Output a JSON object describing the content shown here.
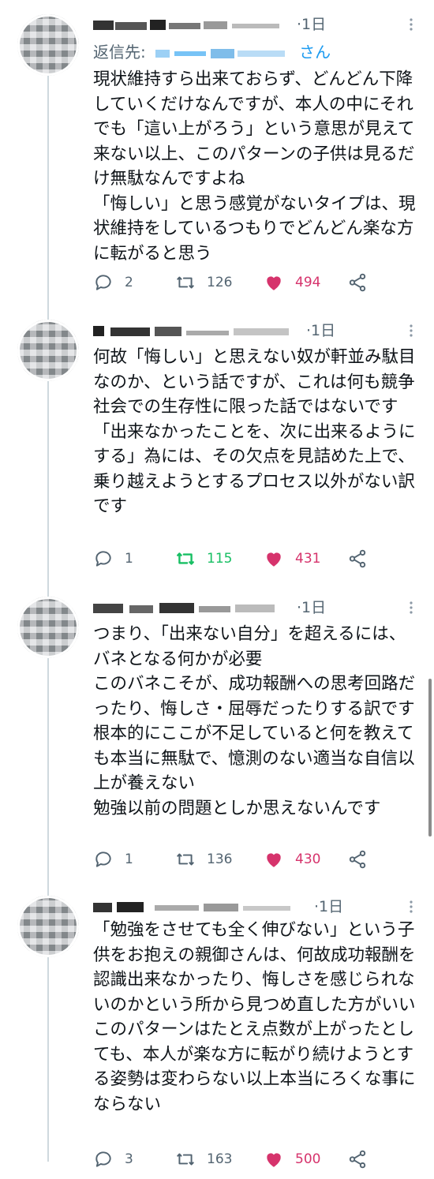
{
  "replying_label": "返信先:",
  "replying_suffix": "さん",
  "tweets": [
    {
      "time": "1日",
      "text": "現状維持すら出来ておらず、どんどん下降していくだけなんですが、本人の中にそれでも「這い上がろう」という意思が見えて来ない以上、このパターンの子供は見るだけ無駄なんですよね\n「悔しい」と思う感覚がないタイプは、現状維持をしているつもりでどんどん楽な方に転がると思う",
      "replies": "2",
      "retweets": "126",
      "likes": "494"
    },
    {
      "time": "1日",
      "text": "何故「悔しい」と思えない奴が軒並み駄目なのか、という話ですが、これは何も競争社会での生存性に限った話ではないです\n「出来なかったことを、次に出来るようにする」為には、その欠点を見詰めた上で、乗り越えようとするプロセス以外がない訳です",
      "replies": "1",
      "retweets": "115",
      "likes": "431"
    },
    {
      "time": "1日",
      "text": "つまり、「出来ない自分」を超えるには、バネとなる何かが必要\nこのバネこそが、成功報酬への思考回路だったり、悔しさ・屈辱だったりする訳です\n根本的にここが不足していると何を教えても本当に無駄で、憶測のない適当な自信以上が養えない\n勉強以前の問題としか思えないんです",
      "replies": "1",
      "retweets": "136",
      "likes": "430"
    },
    {
      "time": "1日",
      "text": "「勉強をさせても全く伸びない」という子供をお抱えの親御さんは、何故成功報酬を認識出来なかったり、悔しさを感じられないのかという所から見つめ直した方がいい\nこのパターンはたとえ点数が上がったとしても、本人が楽な方に転がり続けようとする姿勢は変わらない以上本当にろくな事にならない",
      "replies": "3",
      "retweets": "163",
      "likes": "500"
    }
  ],
  "colors": {
    "like": "#d6336c",
    "retweet_active": "#17bf63",
    "link": "#1d9bf0",
    "muted": "#536471"
  },
  "icons": [
    "reply-icon",
    "retweet-icon",
    "heart-icon",
    "share-icon",
    "more-icon"
  ]
}
